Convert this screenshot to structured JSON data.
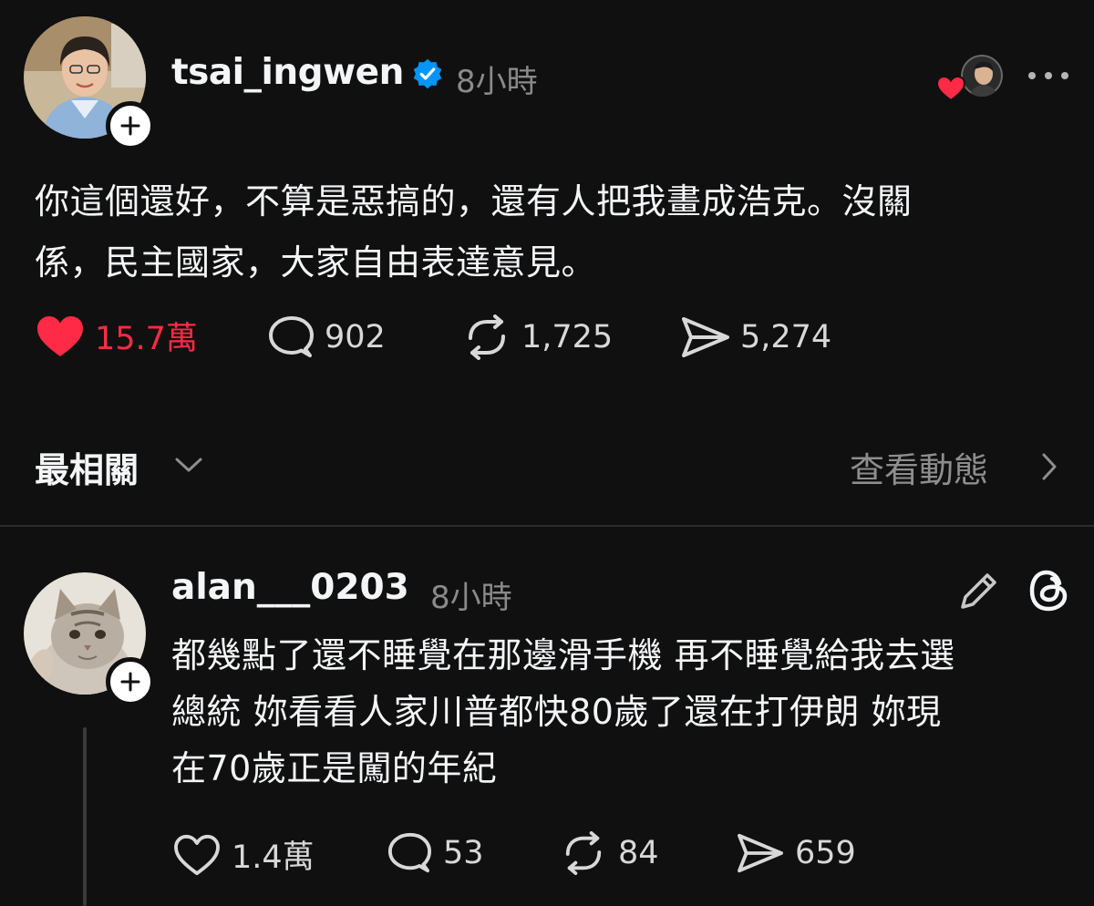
{
  "post": {
    "username": "tsai_ingwen",
    "verified_icon": "verified-badge-icon",
    "time": "8小時",
    "text_lines": [
      "你這個還好，不算是惡搞的，還有人把我畫成浩克。沒關",
      "係，民主國家，大家自由表達意見。"
    ],
    "likes": "15.7萬",
    "liked": true,
    "comments": "902",
    "reposts": "1,725",
    "shares": "5,274"
  },
  "filter": {
    "sort_label": "最相關",
    "activity_label": "查看動態"
  },
  "reply": {
    "username": "alan___0203",
    "time": "8小時",
    "text_lines": [
      "都幾點了還不睡覺在那邊滑手機 再不睡覺給我去選",
      "總統 妳看看人家川普都快80歲了還在打伊朗 妳現",
      "在70歲正是闖的年紀"
    ],
    "likes": "1.4萬",
    "comments": "53",
    "reposts": "84",
    "shares": "659"
  },
  "colors": {
    "background": "#101010",
    "like_red": "#ff2a45",
    "verified_blue": "#0095f6",
    "muted_text": "#8a8a8a"
  }
}
